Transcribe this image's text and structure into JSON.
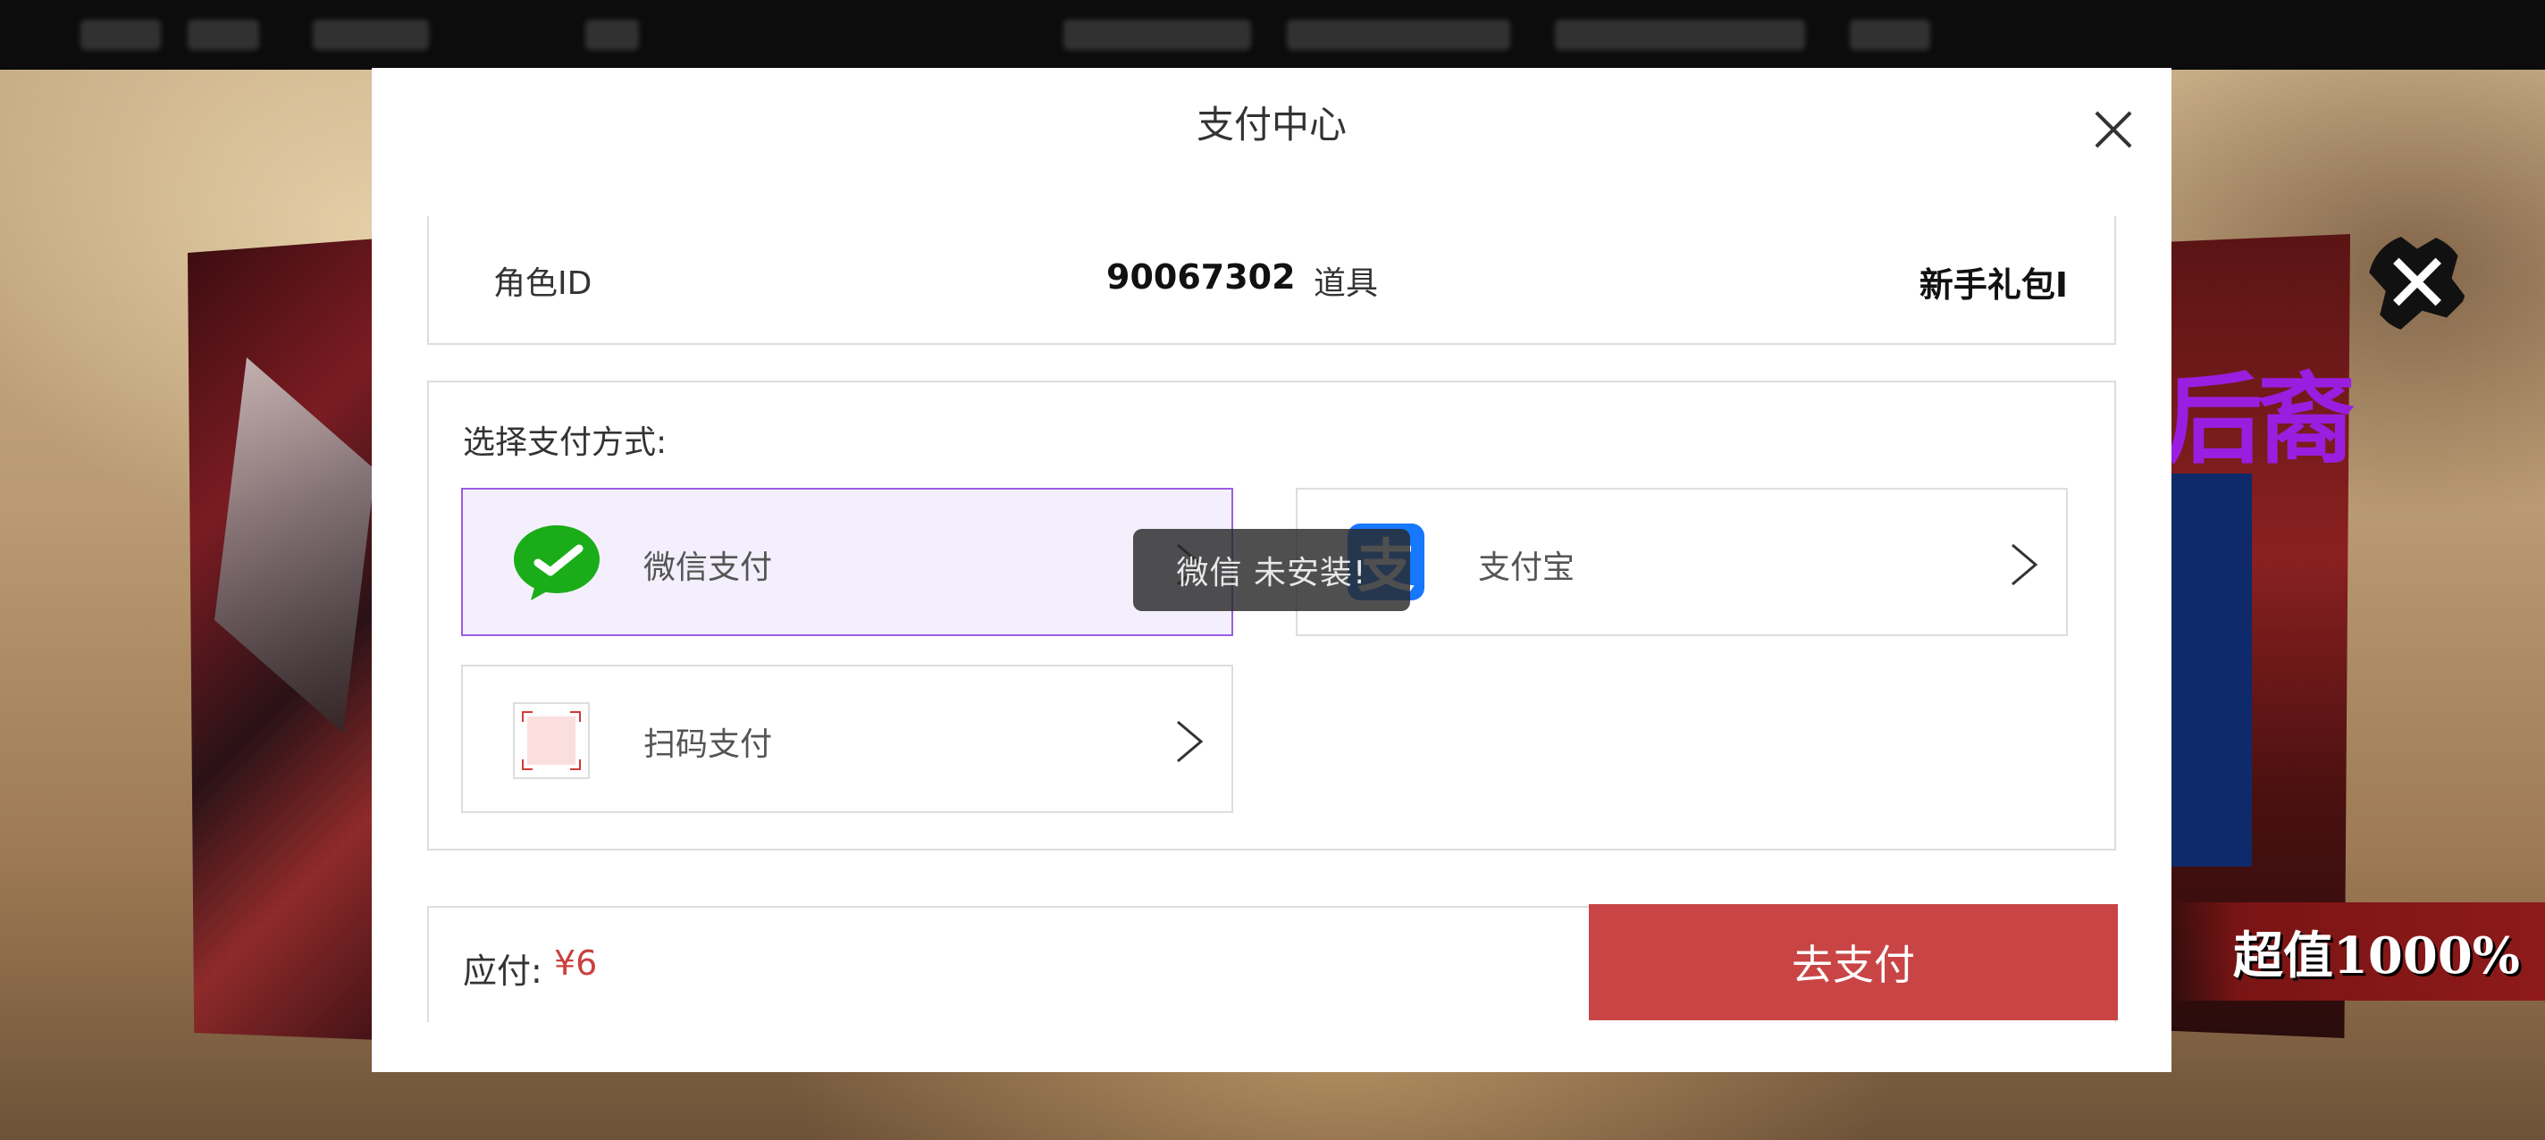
{
  "modal": {
    "title": "支付中心",
    "role_id_label": "角色ID",
    "role_id_value": "90067302",
    "item_label": "道具",
    "item_value": "新手礼包I",
    "payment_heading": "选择支付方式:",
    "options": [
      {
        "label": "微信支付",
        "icon": "wechat-icon",
        "selected": true
      },
      {
        "label": "支付宝",
        "icon": "alipay-icon",
        "selected": false
      },
      {
        "label": "扫码支付",
        "icon": "qr-scan-icon",
        "selected": false
      }
    ],
    "alipay_icon_glyph": "支",
    "toast": "微信 未安装!",
    "amount_label": "应付:",
    "amount_value": "¥6",
    "submit_label": "去支付"
  },
  "game": {
    "banner_text": "超值1000%",
    "poster_title_fragment": "后裔"
  },
  "colors": {
    "accent_red": "#c94545",
    "selected_border": "#9b5ce0",
    "selected_bg": "#f3effd",
    "wechat_green": "#1aad19",
    "alipay_blue": "#1677ff"
  }
}
